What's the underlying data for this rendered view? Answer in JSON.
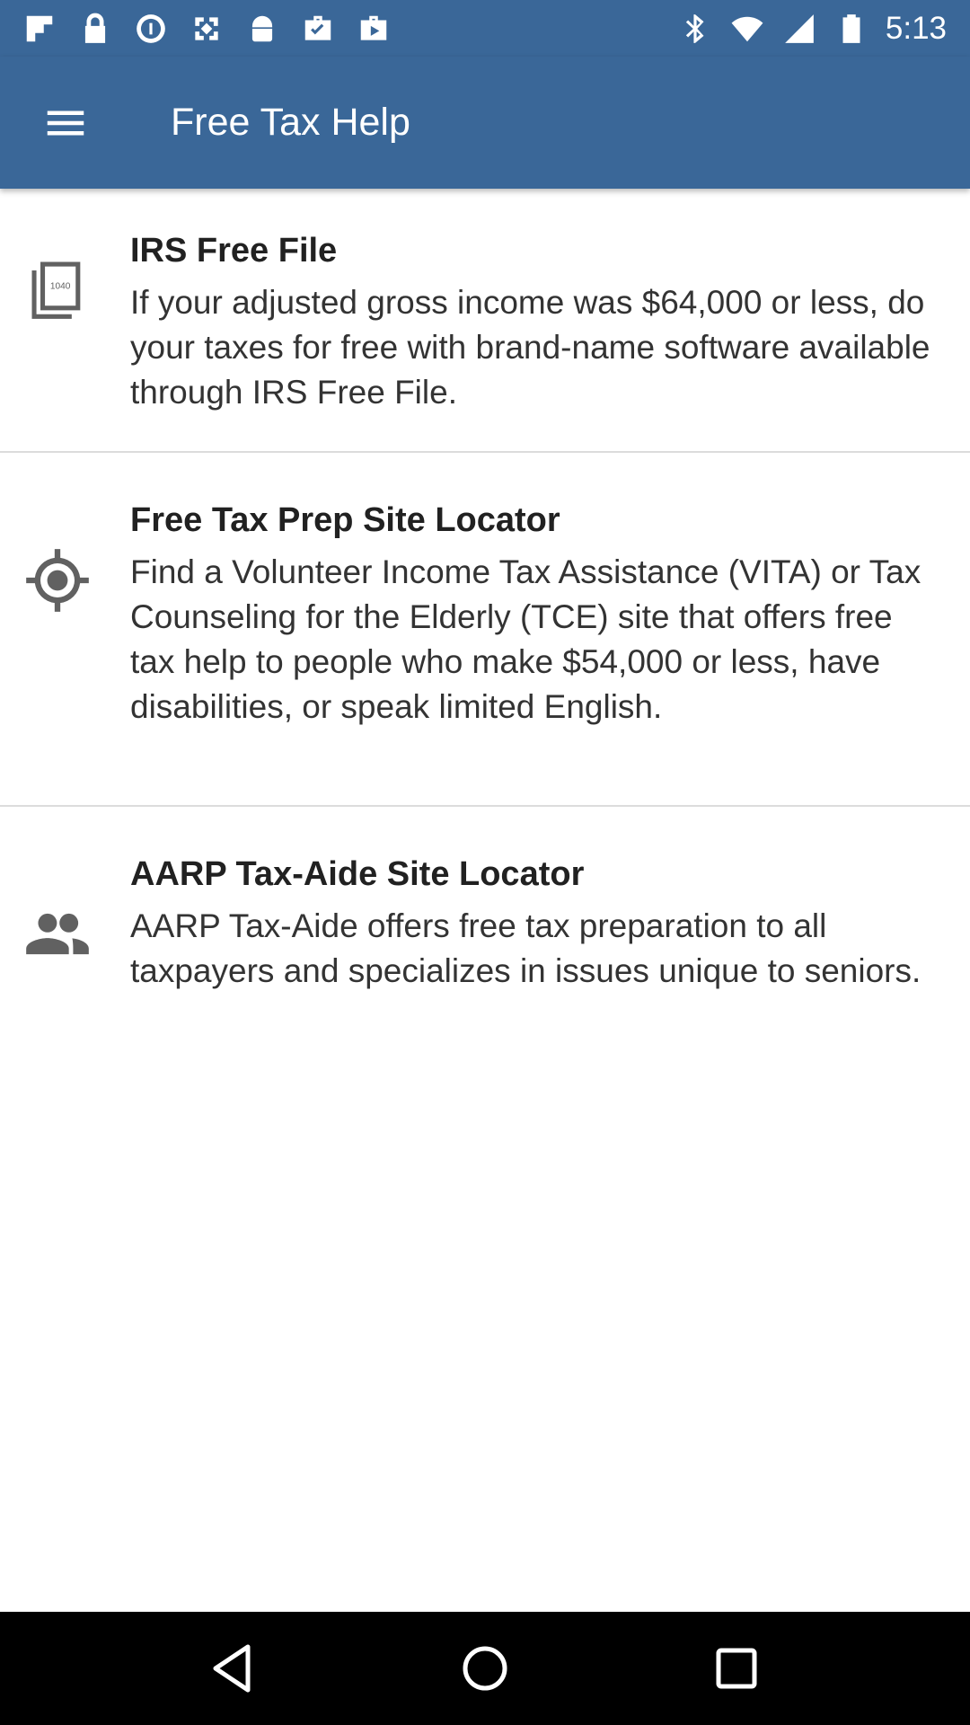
{
  "status_bar": {
    "left_icons": [
      "flipboard-icon",
      "lock-icon",
      "data-saver-icon",
      "fake-gps-icon",
      "android-icon",
      "briefcase-check-icon",
      "play-store-icon"
    ],
    "right_icons": [
      "bluetooth-icon",
      "wifi-icon",
      "signal-icon",
      "battery-icon"
    ],
    "time": "5:13"
  },
  "app_bar": {
    "title": "Free Tax Help"
  },
  "items": [
    {
      "icon": "form-1040-icon",
      "icon_label": "1040",
      "title": "IRS Free File",
      "description": "If your adjusted gross income was $64,000 or less, do your taxes for free with brand-name software available through IRS Free File."
    },
    {
      "icon": "locator-target-icon",
      "title": "Free Tax Prep Site Locator",
      "description": "Find a Volunteer Income Tax Assistance (VITA) or Tax Counseling for the Elderly (TCE) site that offers free tax help to people who make $54,000 or less, have disabilities, or speak limited English."
    },
    {
      "icon": "people-icon",
      "title": "AARP Tax-Aide Site Locator",
      "description": "AARP Tax-Aide offers free tax preparation to all taxpayers and specializes in issues unique to seniors."
    }
  ],
  "colors": {
    "primary": "#3a6798",
    "icon_gray": "#616161",
    "divider": "#dcdcdc"
  }
}
